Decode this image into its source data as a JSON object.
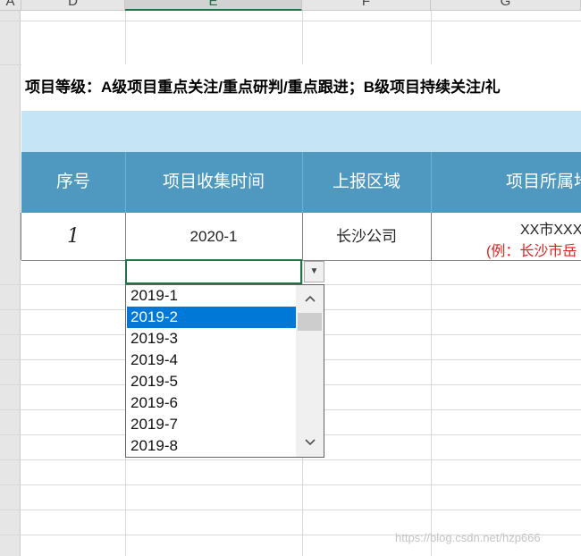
{
  "columns": [
    "A",
    "D",
    "E",
    "F",
    "G"
  ],
  "notice": "项目等级：A级项目重点关注/重点研判/重点跟进；B级项目持续关注/礼",
  "headers": [
    "序号",
    "项目收集时间",
    "上报区域",
    "项目所属地"
  ],
  "row": {
    "index": "1",
    "time": "2020-1",
    "area": "长沙公司",
    "location_line1": "XX市XXX",
    "location_line2": "(例：长沙市岳"
  },
  "dropdown": {
    "selected": "2019-2",
    "options": [
      "2019-1",
      "2019-2",
      "2019-3",
      "2019-4",
      "2019-5",
      "2019-6",
      "2019-7",
      "2019-8"
    ]
  },
  "watermark": "https://blog.csdn.net/hzp666",
  "colors": {
    "header_band": "#4f98c0",
    "light_band": "#c5e5f6",
    "selection": "#0078d7",
    "active_border": "#217346",
    "note_red": "#e02020"
  }
}
